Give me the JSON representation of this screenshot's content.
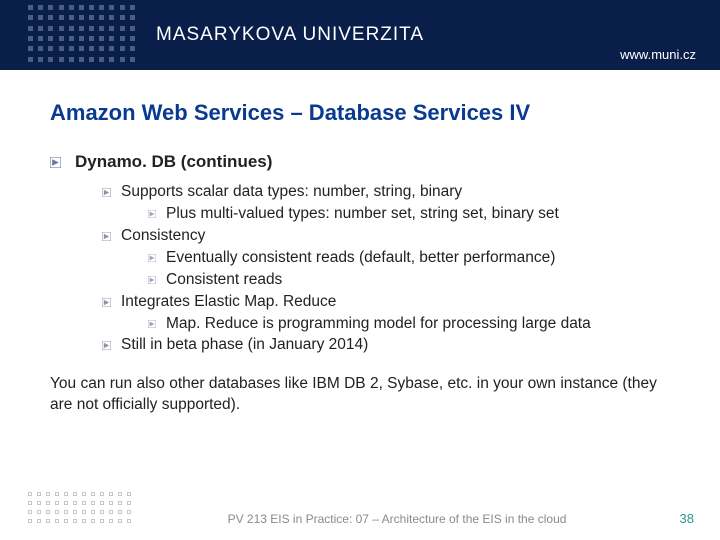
{
  "header": {
    "university": "MASARYKOVA UNIVERZITA",
    "url": "www.muni.cz"
  },
  "title": "Amazon Web Services – Database Services IV",
  "section": "Dynamo. DB (continues)",
  "items": [
    {
      "text": "Supports scalar data types: number, string, binary",
      "children": [
        {
          "text": "Plus multi-valued types: number set, string set, binary set"
        }
      ]
    },
    {
      "text": "Consistency",
      "children": [
        {
          "text": "Eventually consistent reads (default, better performance)"
        },
        {
          "text": "Consistent reads"
        }
      ]
    },
    {
      "text": "Integrates Elastic Map. Reduce",
      "children": [
        {
          "text": "Map. Reduce is programming model for processing large data"
        }
      ]
    },
    {
      "text": "Still in beta phase (in January 2014)",
      "children": []
    }
  ],
  "paragraph": "You can run also other databases like IBM DB 2, Sybase, etc. in your own instance (they are not officially supported).",
  "footer": {
    "text": "PV 213 EIS in Practice: 07 – Architecture of the EIS in the cloud",
    "page": "38"
  }
}
